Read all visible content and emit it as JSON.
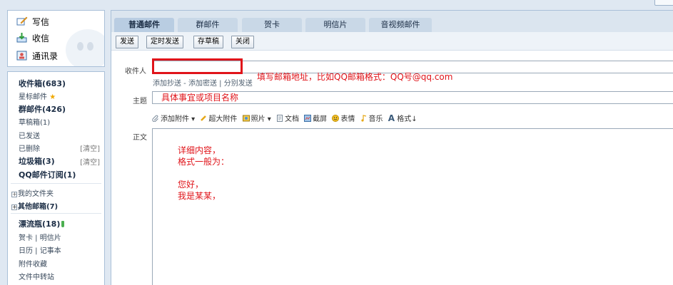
{
  "sidebar": {
    "quick": [
      {
        "label": "写信",
        "icon": "pen-icon"
      },
      {
        "label": "收信",
        "icon": "inbox-arrow-icon"
      },
      {
        "label": "通讯录",
        "icon": "address-book-icon"
      }
    ],
    "folders": {
      "inbox": "收件箱(683)",
      "starred": "星标邮件",
      "group": "群邮件(426)",
      "drafts": "草稿箱(1)",
      "sent": "已发送",
      "deleted": "已删除",
      "deleted_clear": "[清空]",
      "spam": "垃圾箱(3)",
      "spam_clear": "[清空]",
      "qq_sub": "QQ邮件订阅(1)"
    },
    "tree": {
      "my_folders": "我的文件夹",
      "other_mailbox": "其他邮箱(7)"
    },
    "extras": {
      "drift_bottle": "漂流瓶(18)",
      "card_line": "贺卡 | 明信片",
      "calendar_line": "日历 | 记事本",
      "attachments": "附件收藏",
      "transfer": "文件中转站"
    }
  },
  "tabs": [
    "普通邮件",
    "群邮件",
    "贺卡",
    "明信片",
    "音视频邮件"
  ],
  "toolbar": {
    "send": "发送",
    "scheduled": "定时发送",
    "save_draft": "存草稿",
    "close": "关闭"
  },
  "compose": {
    "to_label": "收件人",
    "add_cc": "添加抄送",
    "dash": " - ",
    "add_bcc": "添加密送",
    "pipe": " | ",
    "separate_send": "分别发送",
    "to_hint": "填写邮箱地址，比如QQ邮箱格式：QQ号@qq.com",
    "subject_label": "主题",
    "subject_value": "具体事宜或项目名称",
    "body_label": "正文",
    "attach_bar": {
      "attach": "添加附件",
      "big_attach": "超大附件",
      "photo": "照片",
      "doc": "文档",
      "screenshot": "截屏",
      "emoji": "表情",
      "music": "音乐",
      "format": "格式↓"
    },
    "body_lines": [
      "详细内容，",
      "格式一般为：",
      "",
      "您好，",
      "我是某某，"
    ]
  },
  "colors": {
    "annotation_red": "#e0141a",
    "panel_border": "#a9c0d8",
    "tab_active": "#b9cde2"
  }
}
